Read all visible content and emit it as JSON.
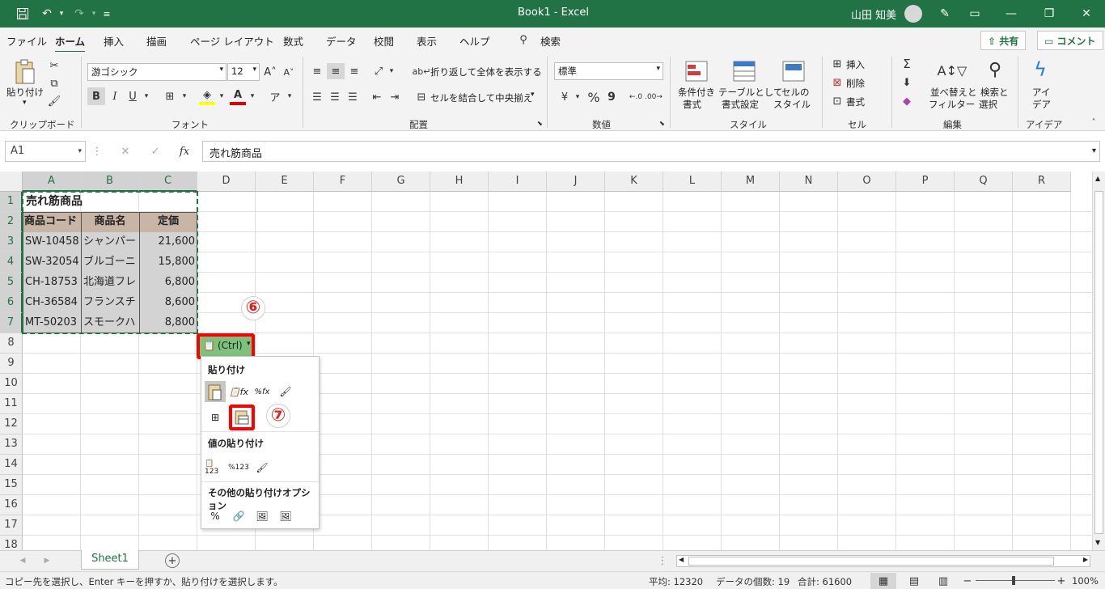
{
  "title_bar": {
    "doc_title": "Book1",
    "separator": "-",
    "app_name": "Excel",
    "user_name": "山田 知美"
  },
  "menu": {
    "tabs": [
      "ファイル",
      "ホーム",
      "挿入",
      "描画",
      "ページ レイアウト",
      "数式",
      "データ",
      "校閲",
      "表示",
      "ヘルプ"
    ],
    "search_label": "検索",
    "share_label": "共有",
    "comment_label": "コメント"
  },
  "ribbon": {
    "clipboard": {
      "paste_label": "貼り付け",
      "group_label": "クリップボード"
    },
    "font": {
      "font_name": "游ゴシック",
      "font_size": "12",
      "bold": "B",
      "italic": "I",
      "underline": "U",
      "group_label": "フォント"
    },
    "alignment": {
      "wrap_label": "折り返して全体を表示する",
      "merge_label": "セルを結合して中央揃え",
      "group_label": "配置"
    },
    "number": {
      "format": "標準",
      "percent": "%",
      "comma": "9",
      "group_label": "数値"
    },
    "styles": {
      "conditional": [
        "条件付き",
        "書式"
      ],
      "table": [
        "テーブルとして",
        "書式設定"
      ],
      "cell_style": [
        "セルの",
        "スタイル"
      ],
      "group_label": "スタイル"
    },
    "cells": {
      "insert": "挿入",
      "delete": "削除",
      "format": "書式",
      "group_label": "セル"
    },
    "editing": {
      "sort": [
        "並べ替えと",
        "フィルター"
      ],
      "find": [
        "検索と",
        "選択"
      ],
      "group_label": "編集"
    },
    "ideas": {
      "label": [
        "アイ",
        "デア"
      ],
      "group_label": "アイデア"
    }
  },
  "formula_bar": {
    "name_box": "A1",
    "fx": "fx",
    "content": "売れ筋商品"
  },
  "grid": {
    "columns": [
      "A",
      "B",
      "C",
      "D",
      "E",
      "F",
      "G",
      "H",
      "I",
      "J",
      "K",
      "L",
      "M",
      "N",
      "O",
      "P",
      "Q",
      "R"
    ],
    "rows": [
      "1",
      "2",
      "3",
      "4",
      "5",
      "6",
      "7",
      "8",
      "9",
      "10",
      "11",
      "12",
      "13",
      "14",
      "15",
      "16",
      "17",
      "18"
    ],
    "table_title": "売れ筋商品",
    "headers": [
      "商品コード",
      "商品名",
      "定価"
    ],
    "data": [
      [
        "SW-10458",
        "シャンパー",
        "21,600"
      ],
      [
        "SW-32054",
        "ブルゴーニ",
        "15,800"
      ],
      [
        "CH-18753",
        "北海道フレ",
        "6,800"
      ],
      [
        "CH-36584",
        "フランスチ",
        "8,600"
      ],
      [
        "MT-50203",
        "スモークハ",
        "8,800"
      ]
    ]
  },
  "paste_popup": {
    "tag_label": "(Ctrl)",
    "section_paste": "貼り付け",
    "section_values": "値の貼り付け",
    "section_other": "その他の貼り付けオプション",
    "step6": "⑥",
    "step7": "⑦"
  },
  "sheet_tabs": {
    "active": "Sheet1",
    "add": "+"
  },
  "status_bar": {
    "message": "コピー先を選択し、Enter キーを押すか、貼り付けを選択します。",
    "average": "平均: 12320",
    "count": "データの個数: 19",
    "sum": "合計: 61600",
    "zoom": "100%"
  },
  "colors": {
    "brand": "#217346",
    "header_fill": "#c9b5a6",
    "highlight": "#ff0000"
  }
}
